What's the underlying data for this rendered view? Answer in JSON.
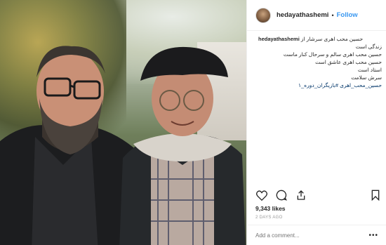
{
  "post": {
    "username": "hedayathashemi",
    "separator": "•",
    "follow_label": "Follow",
    "caption": {
      "username": "hedayathashemi",
      "lines": [
        "حسین محب اهری سرشار از",
        "زندگی است",
        "حسین محب اهری سالم و سرحال کنار ماست",
        "حسین محب اهری عاشق است",
        "استاد است",
        "سرش سلامت",
        "حسین_محب_اهری #بازیگران_دوره_۱"
      ]
    },
    "likes": "9,343 likes",
    "time": "2 DAYS AGO",
    "comment_placeholder": "Add a comment...",
    "more_label": "•••"
  },
  "icons": {
    "like": "heart-icon",
    "comment": "comment-icon",
    "share": "share-icon",
    "save": "bookmark-icon",
    "more": "more-options-icon"
  },
  "colors": {
    "link_blue": "#3897f0",
    "text": "#262626",
    "muted": "#999999",
    "border": "#efefef"
  }
}
